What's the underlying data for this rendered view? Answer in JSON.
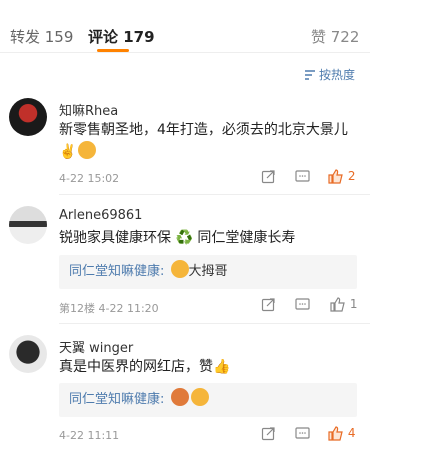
{
  "tabs": {
    "repost": "转发 159",
    "comments": "评论 179",
    "likes": "赞 722"
  },
  "sort_label": "按热度",
  "comments": [
    {
      "user": "知嘛Rhea",
      "text": "新零售朝圣地，4年打造，必须去的北京大景儿 ✌️",
      "time": "4-22 15:02",
      "like_count": "2",
      "liked": true
    },
    {
      "user": "Arlene69861",
      "text": "锐驰家具健康环保 ♻️ 同仁堂健康长寿",
      "reply_user": "同仁堂知嘛健康:",
      "reply_text": "大拇哥",
      "floor_time": "第12楼  4-22 11:20",
      "like_count": "1",
      "liked": false
    },
    {
      "user": "天翼 winger",
      "text": "真是中医界的网红店，赞👍",
      "reply_user": "同仁堂知嘛健康:",
      "reply_text": "",
      "time": "4-22 11:11",
      "like_count": "4",
      "liked": true
    }
  ],
  "colors": {
    "accent": "#ff8200",
    "link": "#4f7cae",
    "like": "#e86b25"
  }
}
